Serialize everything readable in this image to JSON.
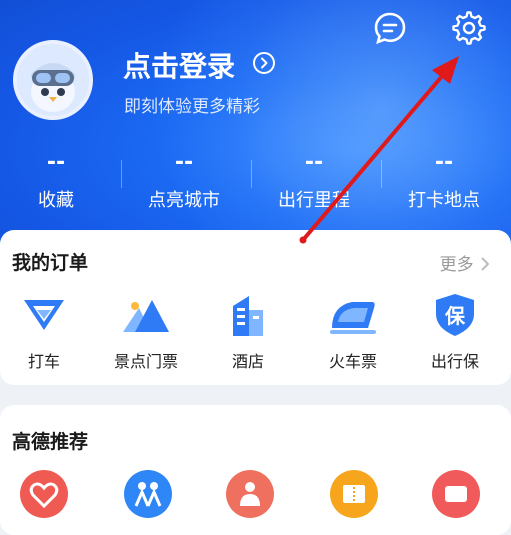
{
  "header": {
    "login_title": "点击登录",
    "login_subtitle": "即刻体验更多精彩",
    "stats": [
      {
        "value": "--",
        "label": "收藏"
      },
      {
        "value": "--",
        "label": "点亮城市"
      },
      {
        "value": "--",
        "label": "出行里程"
      },
      {
        "value": "--",
        "label": "打卡地点"
      }
    ],
    "icons": [
      "message-icon",
      "gear-icon"
    ]
  },
  "orders": {
    "title": "我的订单",
    "more": "更多",
    "items": [
      {
        "label": "打车",
        "icon": "taxi-icon"
      },
      {
        "label": "景点门票",
        "icon": "mountain-icon"
      },
      {
        "label": "酒店",
        "icon": "hotel-icon"
      },
      {
        "label": "火车票",
        "icon": "train-icon"
      },
      {
        "label": "出行保",
        "icon": "shield-icon",
        "glyph": "保"
      }
    ]
  },
  "recommend": {
    "title": "高德推荐"
  },
  "colors": {
    "brand_blue": "#1c6cf4",
    "annotation_red": "#e0191b"
  }
}
